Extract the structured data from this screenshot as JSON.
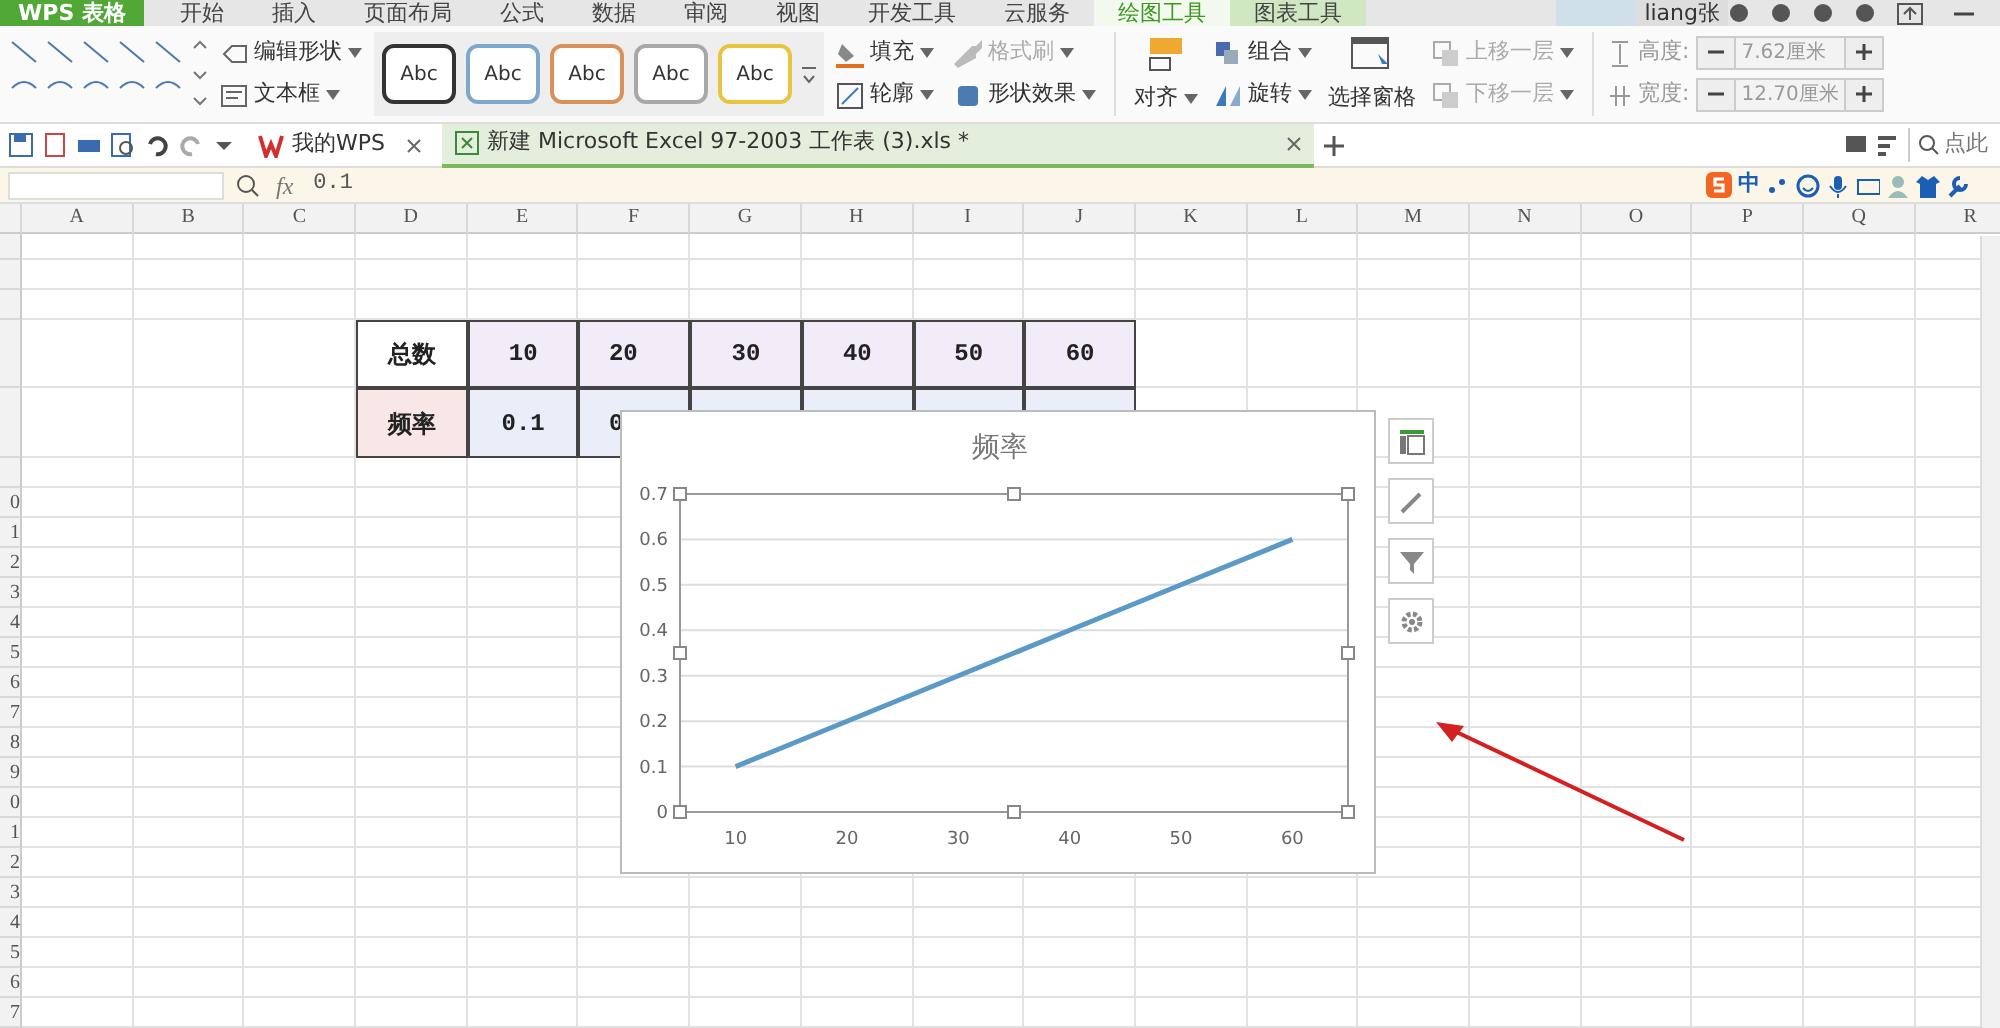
{
  "app_menu": {
    "label": "WPS 表格"
  },
  "menu_tabs": [
    {
      "label": "开始",
      "selected": false,
      "contextual": false
    },
    {
      "label": "插入",
      "selected": false,
      "contextual": false
    },
    {
      "label": "页面布局",
      "selected": false,
      "contextual": false
    },
    {
      "label": "公式",
      "selected": false,
      "contextual": false
    },
    {
      "label": "数据",
      "selected": false,
      "contextual": false
    },
    {
      "label": "审阅",
      "selected": false,
      "contextual": false
    },
    {
      "label": "视图",
      "selected": false,
      "contextual": false
    },
    {
      "label": "开发工具",
      "selected": false,
      "contextual": false
    },
    {
      "label": "云服务",
      "selected": false,
      "contextual": false
    },
    {
      "label": "绘图工具",
      "selected": true,
      "contextual": true
    },
    {
      "label": "图表工具",
      "selected": false,
      "contextual": true
    }
  ],
  "user": {
    "name": "liang张"
  },
  "ribbon": {
    "edit_shape": "编辑形状",
    "text_box": "文本框",
    "shape_styles": [
      {
        "label": "Abc",
        "color": "#333333"
      },
      {
        "label": "Abc",
        "color": "#7fa7c9"
      },
      {
        "label": "Abc",
        "color": "#d9905a"
      },
      {
        "label": "Abc",
        "color": "#a8a8a8"
      },
      {
        "label": "Abc",
        "color": "#e8c440"
      }
    ],
    "format_buttons": [
      {
        "label": "填充",
        "disabled": false
      },
      {
        "label": "格式刷",
        "disabled": true
      },
      {
        "label": "轮廓",
        "disabled": false
      },
      {
        "label": "形状效果",
        "disabled": false
      }
    ],
    "align": "对齐",
    "arrange_buttons": [
      {
        "label": "组合",
        "disabled": false
      },
      {
        "label": "旋转",
        "disabled": false
      }
    ],
    "selection_pane": "选择窗格",
    "layer_buttons": [
      {
        "label": "上移一层",
        "disabled": true
      },
      {
        "label": "下移一层",
        "disabled": true
      }
    ],
    "size_fields": [
      {
        "label": "高度:",
        "value": "7.62厘米",
        "disabled": true
      },
      {
        "label": "宽度:",
        "value": "12.70厘米",
        "disabled": true
      }
    ]
  },
  "doc_tabs": [
    {
      "label": "我的WPS",
      "selected": false
    },
    {
      "label": "新建 Microsoft Excel 97-2003 工作表 (3).xls *",
      "selected": true
    }
  ],
  "search": {
    "placeholder": "点此"
  },
  "formula_bar": {
    "fx": "fx",
    "value": "0.1"
  },
  "ime_bar": {
    "label": "中"
  },
  "columns": [
    "A",
    "B",
    "C",
    "D",
    "E",
    "F",
    "G",
    "H",
    "I",
    "J",
    "K",
    "L",
    "M",
    "N",
    "O",
    "P",
    "Q",
    "R"
  ],
  "row_labels": [
    "0",
    "1",
    "2",
    "3",
    "4",
    "5",
    "6",
    "7",
    "8",
    "9",
    "0",
    "1",
    "2",
    "3",
    "4",
    "5",
    "6",
    "7"
  ],
  "data_table": [
    {
      "kind": "categories",
      "header": "总数",
      "values": [
        "10",
        "20",
        "30",
        "40",
        "50",
        "60"
      ]
    },
    {
      "kind": "series",
      "header": "频率",
      "values": [
        "0.1",
        "0"
      ]
    }
  ],
  "chart": {
    "chart_data": {
      "type": "line",
      "title": "频率",
      "categories": [
        "10",
        "20",
        "30",
        "40",
        "50",
        "60"
      ],
      "series": [
        {
          "color": "#5b9ac6",
          "values": [
            0.1,
            0.2,
            0.3,
            0.4,
            0.5,
            0.6
          ]
        }
      ],
      "grid": true,
      "ylim": [
        0,
        0.7
      ],
      "yticks": [
        0,
        0.1,
        0.2,
        0.3,
        0.4,
        0.5,
        0.6,
        0.7
      ]
    }
  }
}
